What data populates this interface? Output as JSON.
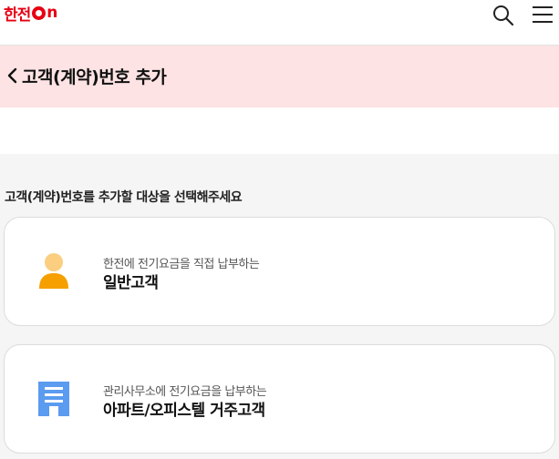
{
  "header": {
    "logo_text": "한전",
    "logo_suffix": "n",
    "icons": [
      "search-icon",
      "menu-icon"
    ]
  },
  "banner": {
    "title": "고객(계약)번호 추가",
    "background": "#fde3e3"
  },
  "main": {
    "instruction": "고객(계약)번호를 추가할 대상을 선택해주세요",
    "options": [
      {
        "description": "한전에 전기요금을 직접 납부하는",
        "name": "일반고객",
        "icon": "person-icon",
        "icon_color": "#f5a000"
      },
      {
        "description": "관리사무소에 전기요금을 납부하는",
        "name": "아파트/오피스텔 거주고객",
        "icon": "apartment-building-icon",
        "icon_color": "#5b9bf0"
      }
    ]
  },
  "colors": {
    "brand_red": "#e60012",
    "page_bg": "#f5f5f5"
  }
}
